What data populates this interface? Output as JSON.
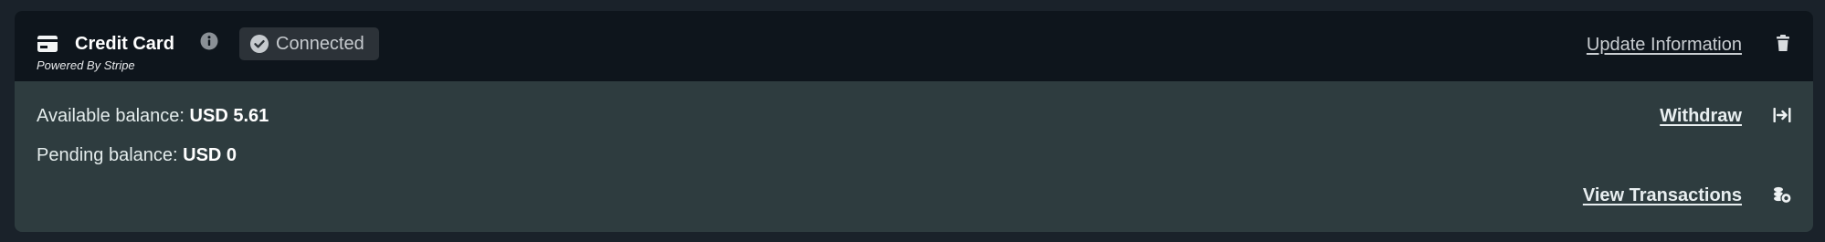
{
  "payment_method": {
    "title": "Credit Card",
    "subtitle": "Powered By Stripe",
    "card_icon": "credit-card-icon",
    "info_icon": "info-icon",
    "status": {
      "icon": "check-circle-icon",
      "label": "Connected"
    },
    "update_link": "Update Information",
    "delete_icon": "trash-icon"
  },
  "balances": {
    "available_label": "Available balance:",
    "available_value": "USD 5.61",
    "pending_label": "Pending balance:",
    "pending_value": "USD 0"
  },
  "actions": {
    "withdraw_label": "Withdraw",
    "withdraw_icon": "arrow-to-line-icon",
    "transactions_label": "View Transactions",
    "transactions_icon": "coins-icon"
  },
  "colors": {
    "page_background": "#1a222a",
    "header_background": "#0e151c",
    "body_background": "#2e3c3f",
    "badge_background": "#2c3238",
    "text_primary": "#ffffff",
    "text_muted": "#c6cace"
  }
}
